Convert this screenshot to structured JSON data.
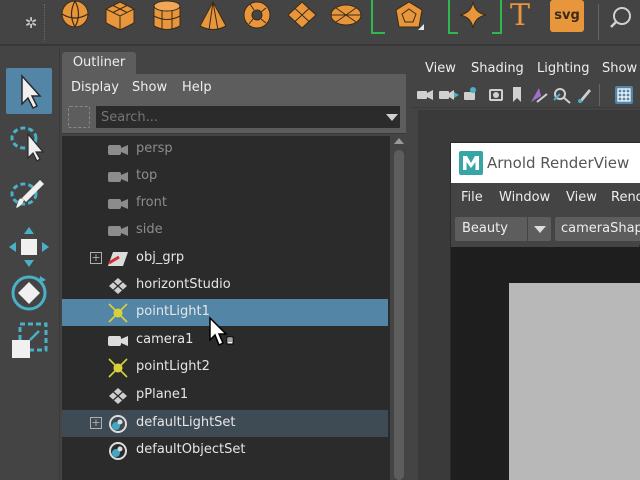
{
  "colors": {
    "accent_selection": "#5285a6",
    "shelf_icon_orange": "#e8963c",
    "light_icon_yellow": "#d8d23a",
    "list_bg": "#2b2b2b",
    "panel_bg": "#444444"
  },
  "shelf": {
    "items": [
      {
        "icon": "sphere-icon"
      },
      {
        "icon": "cube-icon"
      },
      {
        "icon": "cylinder-icon"
      },
      {
        "icon": "cone-icon"
      },
      {
        "icon": "torus-icon"
      },
      {
        "icon": "plane-icon"
      },
      {
        "icon": "disc-icon"
      },
      {
        "icon": "platonic-icon"
      },
      {
        "icon": "superellipse-icon"
      },
      {
        "icon": "type-icon",
        "label": "T"
      },
      {
        "icon": "svg-icon",
        "label": "svg"
      }
    ]
  },
  "toolbox": {
    "tools": [
      {
        "icon": "select-tool-icon",
        "selected": true
      },
      {
        "icon": "lasso-tool-icon"
      },
      {
        "icon": "paint-select-tool-icon"
      },
      {
        "icon": "move-tool-icon"
      },
      {
        "icon": "rotate-tool-icon"
      },
      {
        "icon": "scale-tool-icon"
      }
    ]
  },
  "outliner": {
    "tab_label": "Outliner",
    "menu": [
      "Display",
      "Show",
      "Help"
    ],
    "search_placeholder": "Search...",
    "items": [
      {
        "label": "persp",
        "icon": "camera-icon",
        "dim": true
      },
      {
        "label": "top",
        "icon": "camera-icon",
        "dim": true
      },
      {
        "label": "front",
        "icon": "camera-icon",
        "dim": true
      },
      {
        "label": "side",
        "icon": "camera-icon",
        "dim": true
      },
      {
        "label": "obj_grp",
        "icon": "group-transform-icon",
        "expandable": true
      },
      {
        "label": "horizontStudio",
        "icon": "transform-node-icon"
      },
      {
        "label": "pointLight1",
        "icon": "point-light-icon",
        "selected": true
      },
      {
        "label": "camera1",
        "icon": "camera-icon"
      },
      {
        "label": "pointLight2",
        "icon": "point-light-icon"
      },
      {
        "label": "pPlane1",
        "icon": "transform-node-icon"
      },
      {
        "label": "defaultLightSet",
        "icon": "set-icon",
        "expandable": true,
        "set": true
      },
      {
        "label": "defaultObjectSet",
        "icon": "set-icon"
      }
    ]
  },
  "viewport": {
    "menu": [
      "View",
      "Shading",
      "Lighting",
      "Show"
    ]
  },
  "arnold": {
    "title": "Arnold RenderView",
    "menu": [
      "File",
      "Window",
      "View",
      "Rend"
    ],
    "aov_value": "Beauty",
    "camera_value": "cameraShape"
  }
}
